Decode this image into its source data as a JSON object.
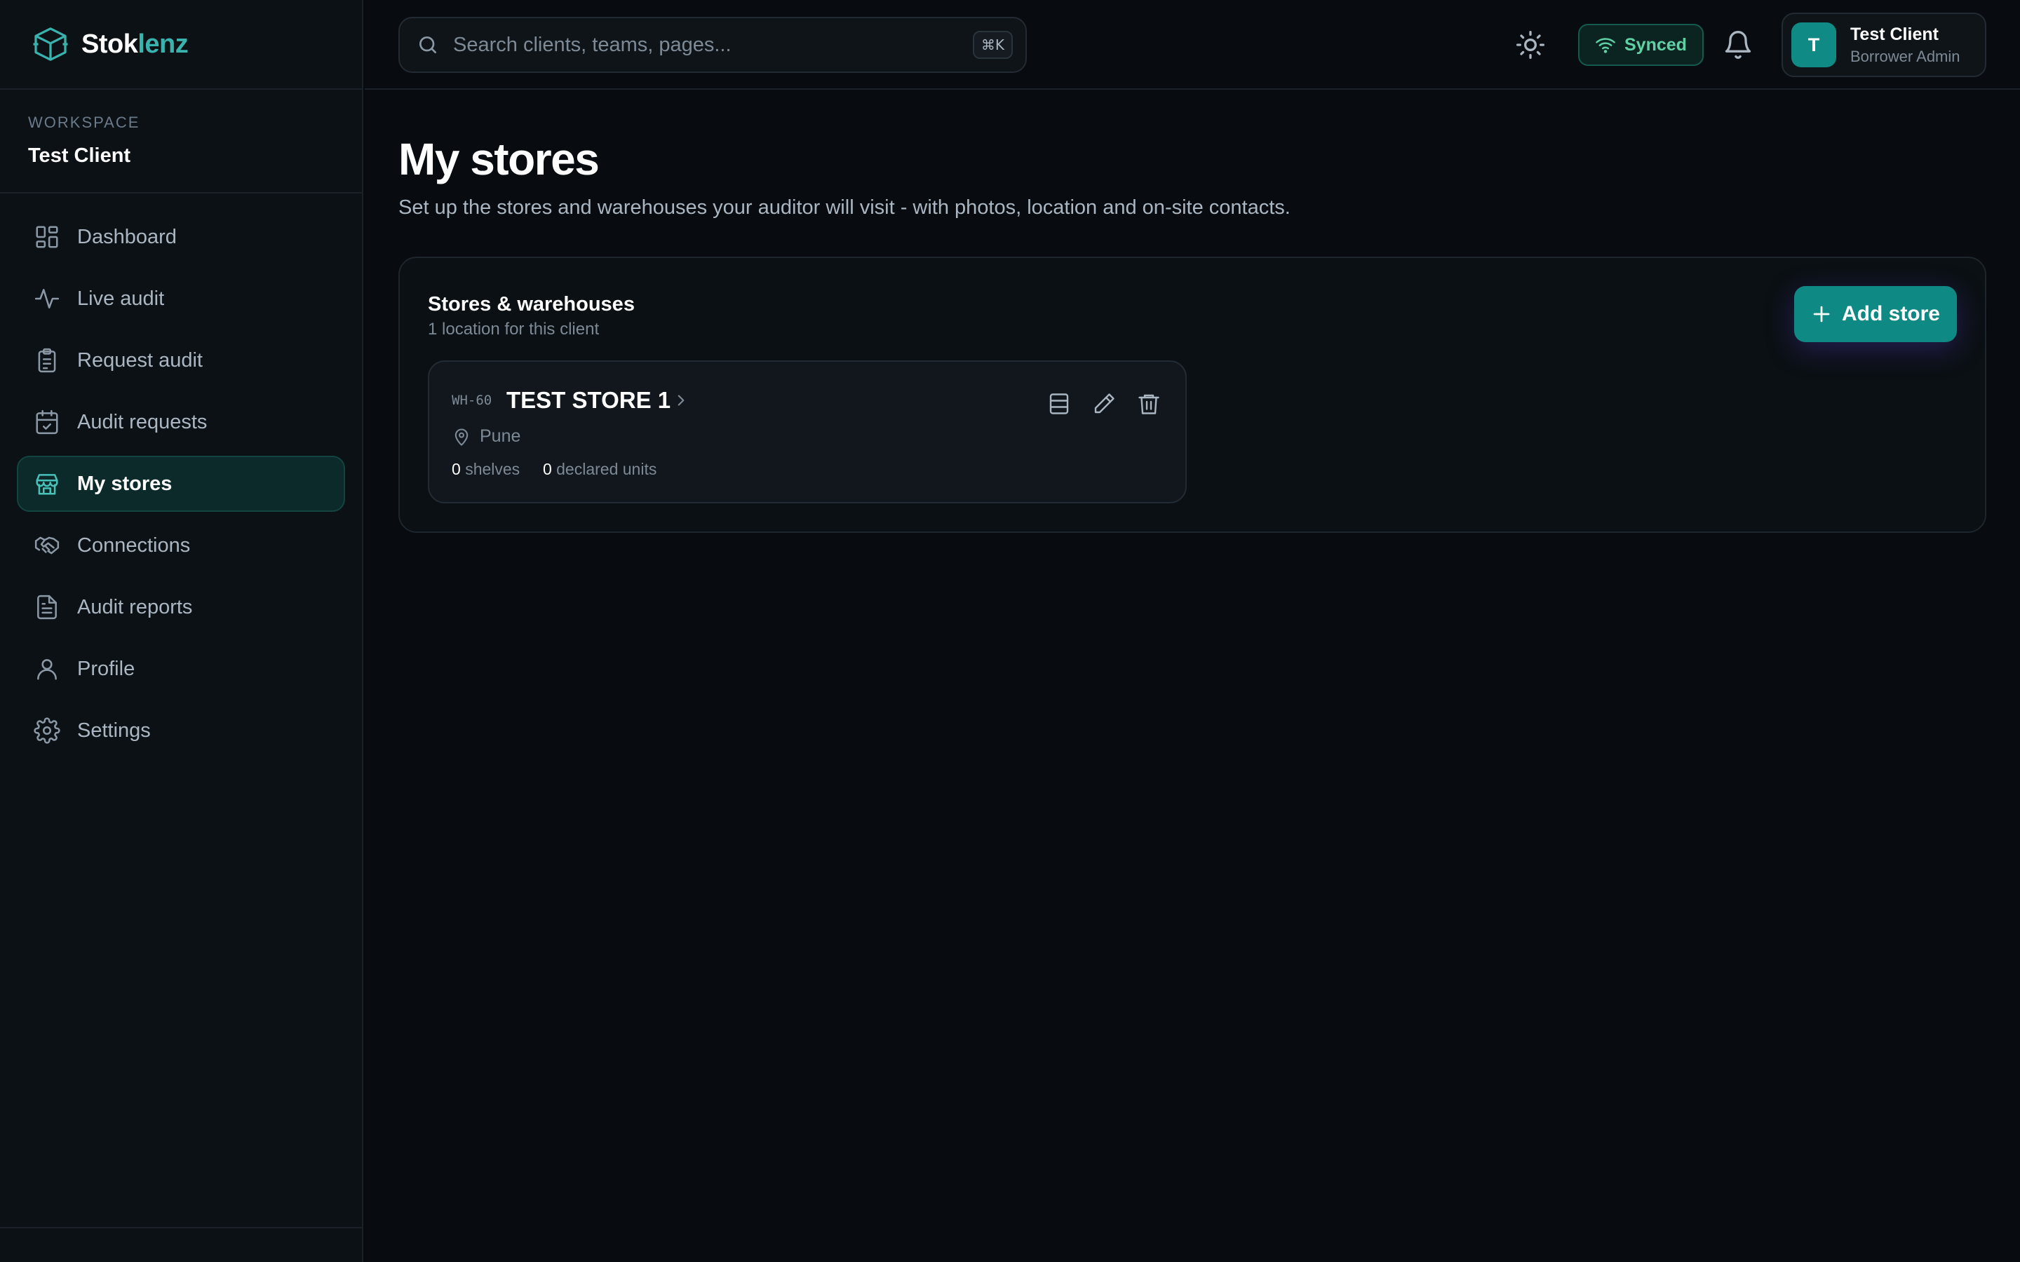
{
  "brand": {
    "name_part1": "Stok",
    "name_part2": "lenz"
  },
  "workspace": {
    "label": "WORKSPACE",
    "name": "Test Client"
  },
  "sidebar": {
    "items": [
      {
        "label": "Dashboard",
        "icon": "dashboard-icon"
      },
      {
        "label": "Live audit",
        "icon": "activity-icon"
      },
      {
        "label": "Request audit",
        "icon": "clipboard-icon"
      },
      {
        "label": "Audit requests",
        "icon": "calendar-check-icon"
      },
      {
        "label": "My stores",
        "icon": "store-icon",
        "active": true
      },
      {
        "label": "Connections",
        "icon": "handshake-icon"
      },
      {
        "label": "Audit reports",
        "icon": "file-text-icon"
      },
      {
        "label": "Profile",
        "icon": "user-icon"
      },
      {
        "label": "Settings",
        "icon": "gear-icon"
      }
    ]
  },
  "topbar": {
    "search_placeholder": "Search clients, teams, pages...",
    "search_shortcut": "⌘K",
    "sync_status": "Synced",
    "user": {
      "initial": "T",
      "name": "Test Client",
      "role": "Borrower Admin"
    }
  },
  "page": {
    "title": "My stores",
    "subtitle": "Set up the stores and warehouses your auditor will visit - with photos, location and on-site contacts."
  },
  "panel": {
    "title": "Stores & warehouses",
    "subtitle": "1 location for this client",
    "add_label": "Add store"
  },
  "stores": [
    {
      "code": "WH-60",
      "name": "TEST STORE 1",
      "location": "Pune",
      "shelves": "0",
      "shelves_label": "shelves",
      "units": "0",
      "units_label": "declared units"
    }
  ],
  "colors": {
    "accent": "#0f8983",
    "accent_text": "#39b3ad",
    "background": "#080c10",
    "sidebar": "#0c1116",
    "synced": "#5fd1a4"
  }
}
